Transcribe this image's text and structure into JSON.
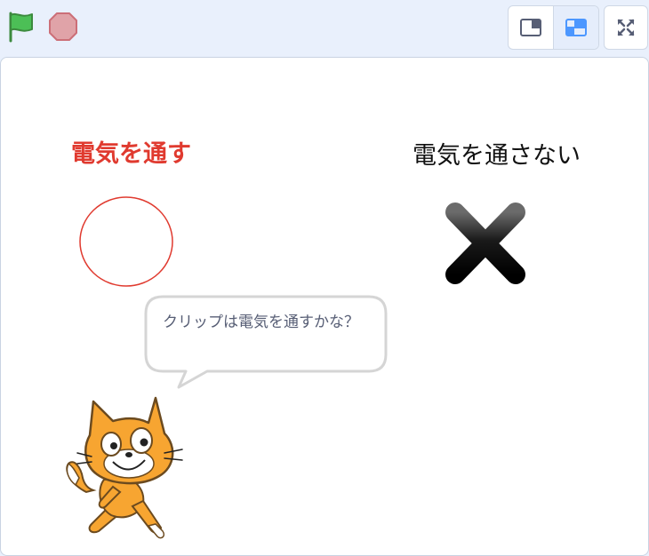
{
  "toolbar": {
    "green_flag_icon": "green-flag-icon",
    "stop_icon": "stop-sign-icon",
    "small_stage_icon": "small-stage-layout-icon",
    "normal_stage_icon": "normal-stage-layout-icon",
    "fullscreen_icon": "fullscreen-icon"
  },
  "stage": {
    "label_conducts": "電気を通す",
    "label_no_conduct": "電気を通さない",
    "circle_icon": "circle-mark-icon",
    "cross_icon": "cross-mark-icon",
    "sprite_icon": "scratch-cat-icon",
    "speech": "クリップは電気を通すかな？"
  },
  "colors": {
    "accent": "#4c97ff",
    "conducts_red": "#e03a2f",
    "flag_green": "#4cbf56",
    "stop_red": "#ec5959",
    "cat_orange": "#f7a531"
  }
}
